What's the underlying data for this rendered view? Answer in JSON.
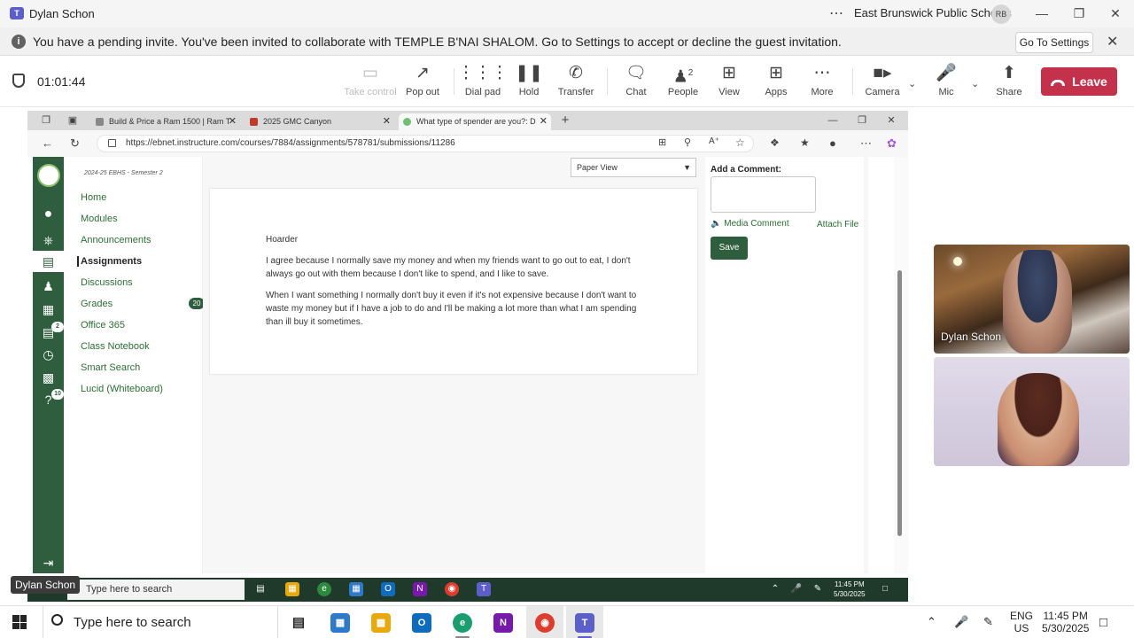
{
  "titlebar": {
    "app_name": "Dylan Schon",
    "more": "⋯",
    "organization": "East Brunswick Public Schools",
    "avatar_initials": "RB"
  },
  "banner": {
    "message": "You have a pending invite. You've been invited to collaborate with TEMPLE B'NAI SHALOM. Go to Settings to accept or decline the guest invitation.",
    "button_label": "Go To Settings"
  },
  "meeting": {
    "timer": "01:01:44",
    "toolbar": {
      "take_control": "Take control",
      "pop_out": "Pop out",
      "dial_pad": "Dial pad",
      "hold": "Hold",
      "transfer": "Transfer",
      "chat": "Chat",
      "people": "People",
      "people_count": "2",
      "view": "View",
      "apps": "Apps",
      "more": "More",
      "camera": "Camera",
      "mic": "Mic",
      "share": "Share",
      "leave": "Leave"
    }
  },
  "browser": {
    "tabs": [
      {
        "title": "Build & Price a Ram 1500 | Ram T"
      },
      {
        "title": "2025 GMC Canyon"
      },
      {
        "title": "What type of spender are you?: D"
      }
    ],
    "new_tab": "+",
    "url": "https://ebnet.instructure.com/courses/7884/assignments/578781/submissions/11286"
  },
  "canvas": {
    "term": "2024-25 EBHS - Semester 2",
    "course_nav": [
      {
        "label": "Home"
      },
      {
        "label": "Modules"
      },
      {
        "label": "Announcements"
      },
      {
        "label": "Assignments"
      },
      {
        "label": "Discussions"
      },
      {
        "label": "Grades"
      },
      {
        "label": "Office 365"
      },
      {
        "label": "Class Notebook"
      },
      {
        "label": "Smart Search"
      },
      {
        "label": "Lucid (Whiteboard)"
      }
    ],
    "grades_badge": "20",
    "inbox_badge": "2",
    "help_badge": "10",
    "view_select": "Paper View",
    "document": {
      "title": "Hoarder",
      "paragraphs": [
        "I agree because I normally save my money and when my friends want to go out to eat, I don't always go out with them because I don't like to spend, and I like to save.",
        "When I want something I normally don't buy it even if it's not expensive because I don't want to waste my money but if I have a job to do and I'll be making a lot more than what I am spending than ill buy it sometimes."
      ]
    },
    "comment": {
      "label": "Add a Comment:",
      "media_comment": "Media Comment",
      "attach_file": "Attach File",
      "save": "Save"
    }
  },
  "shared_taskbar": {
    "search_placeholder": "Type here to search",
    "time": "11:45 PM",
    "date": "5/30/2025"
  },
  "presenter_tag": "Dylan Schon",
  "video_tiles": [
    {
      "name": "Dylan Schon"
    }
  ],
  "taskbar": {
    "search_placeholder": "Type here to search",
    "language": "ENG",
    "region": "US",
    "time": "11:45 PM",
    "date": "5/30/2025"
  },
  "colors": {
    "teams_accent": "#5b5fc7",
    "leave_red": "#c4314b",
    "canvas_green": "#2e5e3e",
    "link_green": "#2c6e33"
  }
}
